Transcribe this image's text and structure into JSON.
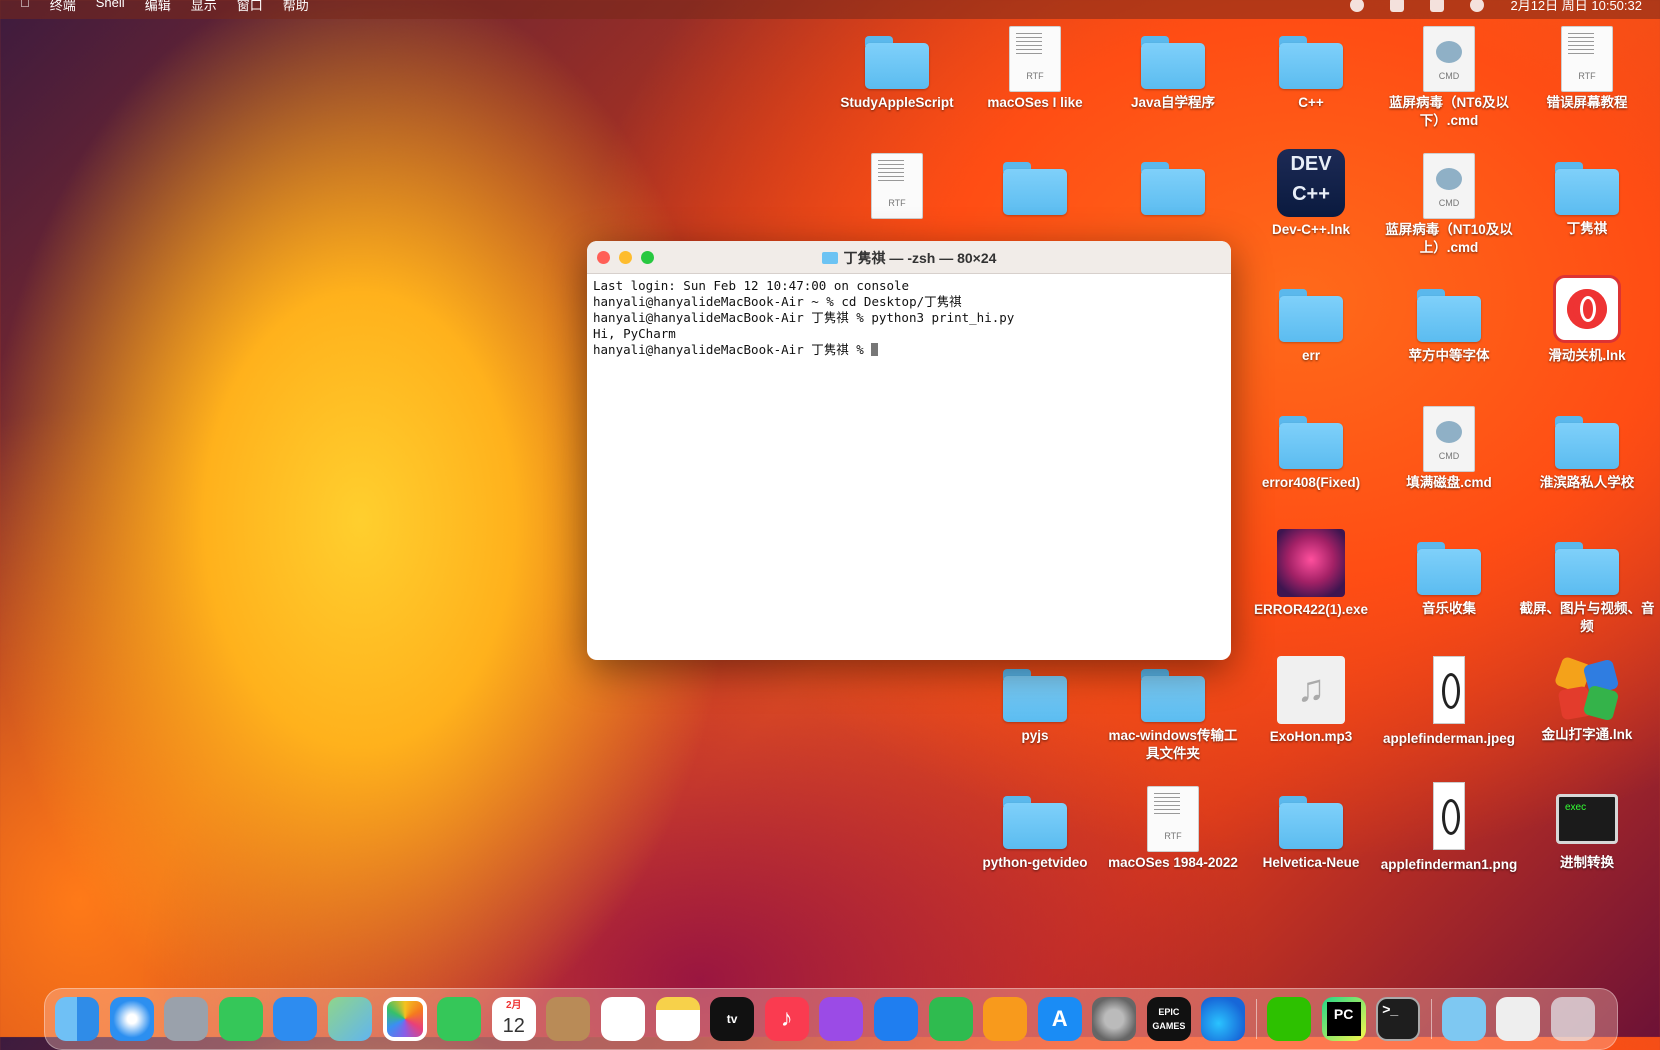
{
  "menubar": {
    "app_menus": [
      "终端",
      "Shell",
      "编辑",
      "显示",
      "窗口",
      "帮助"
    ],
    "clock": "2月12日 周日 10:50:32"
  },
  "desktop_icons": [
    {
      "label": "StudyAppleScript",
      "type": "folder"
    },
    {
      "label": "macOSes I like",
      "type": "rtf"
    },
    {
      "label": "Java自学程序",
      "type": "folder"
    },
    {
      "label": "C++",
      "type": "folder"
    },
    {
      "label": "蓝屏病毒（NT6及以下）.cmd",
      "type": "cmd"
    },
    {
      "label": "错误屏幕教程",
      "type": "rtf"
    },
    {
      "label": "",
      "type": "rtf"
    },
    {
      "label": "",
      "type": "folder"
    },
    {
      "label": "",
      "type": "folder"
    },
    {
      "label": "Dev-C++.lnk",
      "type": "app"
    },
    {
      "label": "蓝屏病毒（NT10及以上）.cmd",
      "type": "cmd"
    },
    {
      "label": "丁隽祺",
      "type": "folder"
    },
    {
      "label": "err",
      "type": "folder"
    },
    {
      "label": "苹方中等字体",
      "type": "folder"
    },
    {
      "label": "滑动关机.lnk",
      "type": "app"
    },
    {
      "label": "error408(Fixed)",
      "type": "folder"
    },
    {
      "label": "填满磁盘.cmd",
      "type": "cmd"
    },
    {
      "label": "淮滨路私人学校",
      "type": "folder"
    },
    {
      "label": "ERROR422(1).exe",
      "type": "app"
    },
    {
      "label": "音乐收集",
      "type": "folder"
    },
    {
      "label": "截屏、图片与视频、音频",
      "type": "folder"
    },
    {
      "label": "pyjs",
      "type": "folder"
    },
    {
      "label": "mac-windows传输工具文件夹",
      "type": "folder"
    },
    {
      "label": "ExoHon.mp3",
      "type": "mp3"
    },
    {
      "label": "applefinderman.jpeg",
      "type": "image"
    },
    {
      "label": "金山打字通.lnk",
      "type": "app"
    },
    {
      "label": "python-getvideo",
      "type": "folder"
    },
    {
      "label": "macOSes 1984-2022",
      "type": "rtf"
    },
    {
      "label": "Helvetica-Neue",
      "type": "folder"
    },
    {
      "label": "applefinderman1.png",
      "type": "image"
    },
    {
      "label": "进制转换",
      "type": "exec"
    }
  ],
  "icon_texts": {
    "rtf": "RTF",
    "cmd": "CMD",
    "dev": "DEV C++",
    "exec": "exec",
    "epic": "EPIC GAMES",
    "tv": "tv",
    "calendar_month": "2月",
    "calendar_day": "12"
  },
  "terminal": {
    "title": "丁隽祺 — -zsh — 80×24",
    "lines": [
      "Last login: Sun Feb 12 10:47:00 on console",
      "hanyali@hanyalideMacBook-Air ~ % cd Desktop/丁隽祺",
      "hanyali@hanyalideMacBook-Air 丁隽祺 % python3 print_hi.py",
      "Hi, PyCharm",
      "hanyali@hanyalideMacBook-Air 丁隽祺 % "
    ]
  },
  "dock_apps": [
    "Finder",
    "Safari",
    "Launchpad",
    "Messages",
    "Mail",
    "Maps",
    "Photos",
    "FaceTime",
    "Calendar",
    "Contacts",
    "Reminders",
    "Notes",
    "TV",
    "Music",
    "Podcasts",
    "Keynote",
    "Numbers",
    "Pages",
    "App Store",
    "System Settings",
    "Epic Games",
    "Edge",
    "WeChat",
    "PyCharm",
    "Terminal",
    "Downloads",
    "Stack",
    "Trash"
  ],
  "colors": {
    "close": "#ff5f57",
    "minimize": "#febc2e",
    "zoom": "#28c840",
    "folder": "#6cc3f3"
  }
}
